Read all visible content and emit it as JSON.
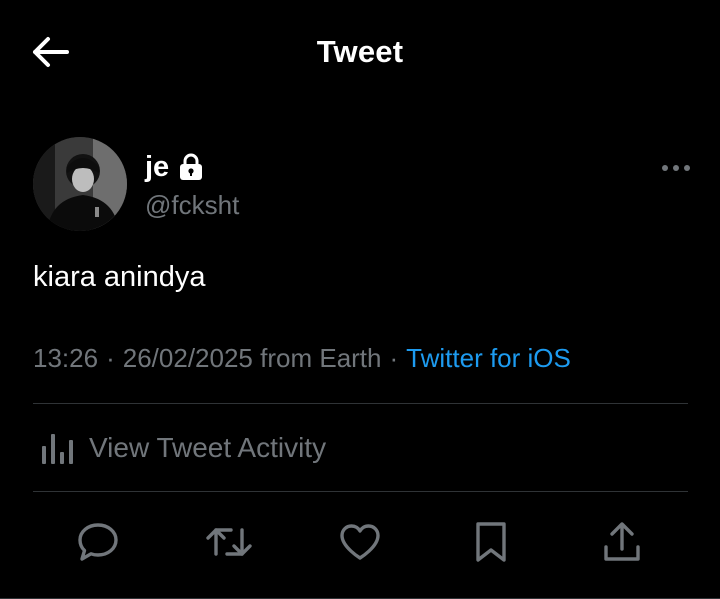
{
  "header": {
    "title": "Tweet",
    "back_icon": "arrow-left-icon"
  },
  "tweet": {
    "author": {
      "display_name": "je",
      "handle": "@fcksht",
      "protected_icon": "lock-icon"
    },
    "text": "kiara anindya",
    "time": "13:26",
    "date": "26/02/2025",
    "location": "from Earth",
    "source": "Twitter for iOS",
    "separator": "·"
  },
  "activity": {
    "label": "View Tweet Activity",
    "icon": "analytics-bars-icon"
  },
  "actions": [
    {
      "name": "reply",
      "icon": "reply-bubble-icon"
    },
    {
      "name": "retweet",
      "icon": "retweet-icon"
    },
    {
      "name": "like",
      "icon": "heart-icon"
    },
    {
      "name": "bookmark",
      "icon": "bookmark-icon"
    },
    {
      "name": "share",
      "icon": "share-upload-icon"
    }
  ],
  "colors": {
    "background": "#000000",
    "text_primary": "#ffffff",
    "text_secondary": "#71767b",
    "link": "#1d9bf0",
    "divider": "#2f3336"
  }
}
